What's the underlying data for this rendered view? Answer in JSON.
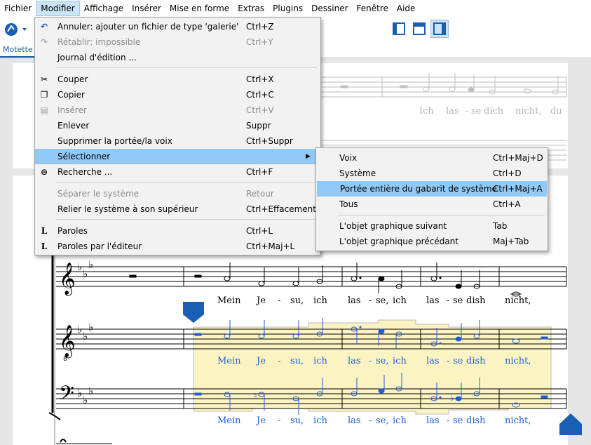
{
  "menubar": [
    "Fichier",
    "Modifier",
    "Affichage",
    "Insérer",
    "Mise en forme",
    "Extras",
    "Plugins",
    "Dessiner",
    "Fenêtre",
    "Aide"
  ],
  "tab": {
    "label": "Motette"
  },
  "edit_menu": {
    "items": [
      {
        "label": "Annuler: ajouter un fichier de type 'galerie'",
        "shortcut": "Ctrl+Z",
        "icon": "undo-icon",
        "disabled": false
      },
      {
        "label": "Rétablir: impossible",
        "shortcut": "Ctrl+Y",
        "icon": "redo-icon",
        "disabled": true
      },
      {
        "label": "Journal d'édition ...",
        "shortcut": "",
        "icon": "",
        "disabled": false
      },
      {
        "label": "Couper",
        "shortcut": "Ctrl+X",
        "icon": "scissors-icon",
        "disabled": false
      },
      {
        "label": "Copier",
        "shortcut": "Ctrl+C",
        "icon": "copy-icon",
        "disabled": false
      },
      {
        "label": "Insérer",
        "shortcut": "Ctrl+V",
        "icon": "paste-icon",
        "disabled": true
      },
      {
        "label": "Enlever",
        "shortcut": "Suppr",
        "icon": "",
        "disabled": false
      },
      {
        "label": "Supprimer la portée/la voix",
        "shortcut": "Ctrl+Suppr",
        "icon": "",
        "disabled": false
      },
      {
        "label": "Sélectionner",
        "shortcut": "",
        "icon": "",
        "disabled": false
      },
      {
        "label": "Recherche ...",
        "shortcut": "Ctrl+F",
        "icon": "search-icon",
        "disabled": false
      },
      {
        "label": "Séparer le système",
        "shortcut": "Retour",
        "icon": "",
        "disabled": true
      },
      {
        "label": "Relier le système à son supérieur",
        "shortcut": "Ctrl+Effacement",
        "icon": "",
        "disabled": false
      },
      {
        "label": "Paroles",
        "shortcut": "Ctrl+L",
        "icon": "lyrics-icon",
        "disabled": false
      },
      {
        "label": "Paroles par l'éditeur",
        "shortcut": "Ctrl+Maj+L",
        "icon": "lyrics-icon",
        "disabled": false
      }
    ]
  },
  "select_submenu": {
    "items": [
      {
        "label": "Voix",
        "shortcut": "Ctrl+Maj+D"
      },
      {
        "label": "Système",
        "shortcut": "Ctrl+D"
      },
      {
        "label": "Portée entière du gabarit de système",
        "shortcut": "Ctrl+Maj+A"
      },
      {
        "label": "Tous",
        "shortcut": "Ctrl+A"
      },
      {
        "label": "L'objet graphique suivant",
        "shortcut": "Tab"
      },
      {
        "label": "L'objet graphique précédant",
        "shortcut": "Maj+Tab"
      }
    ]
  },
  "score": {
    "lyrics_top": [
      "Ich",
      "las",
      "-",
      "se",
      "dich",
      "nicht,",
      "du"
    ],
    "lyrics": [
      "Mein",
      "Je",
      "-",
      "su,",
      "ich",
      "las",
      "-",
      "se,",
      "ich",
      "las",
      "-",
      "se",
      "dish",
      "nicht,"
    ],
    "selection_color": "#1e5fd6",
    "selection_fill": "#fbf4c2"
  }
}
